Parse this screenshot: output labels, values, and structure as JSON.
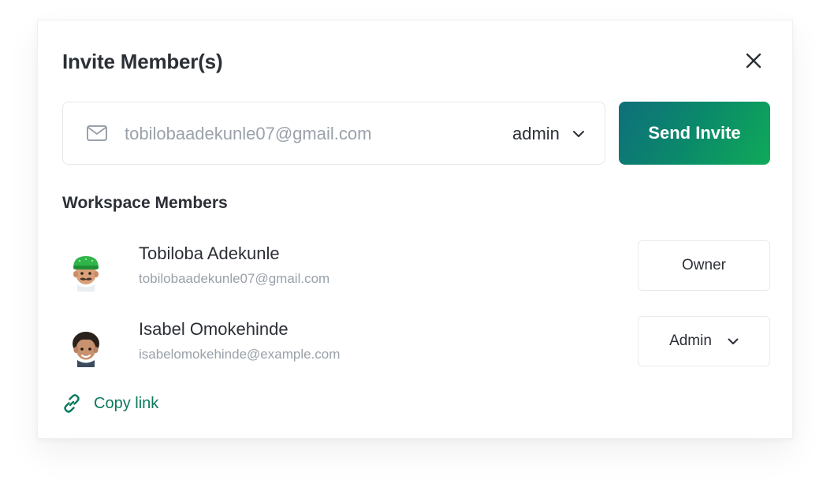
{
  "modal": {
    "title": "Invite Member(s)",
    "close_icon": "close-icon"
  },
  "invite": {
    "email_placeholder": "tobilobaadekunle07@gmail.com",
    "email_value": "",
    "role_selected": "admin",
    "send_label": "Send Invite",
    "icons": {
      "mail": "mail-icon",
      "chevron": "chevron-down-icon"
    }
  },
  "members_section": {
    "title": "Workspace Members",
    "members": [
      {
        "name": "Tobiloba Adekunle",
        "email": "tobilobaadekunle07@gmail.com",
        "role": "Owner",
        "role_editable": false
      },
      {
        "name": "Isabel Omokehinde",
        "email": "isabelomokehinde@example.com",
        "role": "Admin",
        "role_editable": true
      }
    ]
  },
  "copy_link": {
    "label": "Copy link",
    "icon": "link-icon"
  },
  "colors": {
    "accent_green": "#0b7a5e",
    "button_gradient_start": "#0e6f7a",
    "button_gradient_end": "#0faa58",
    "text_primary": "#2b2f36",
    "text_muted": "#9aa1aa",
    "border": "#e5e7eb"
  }
}
